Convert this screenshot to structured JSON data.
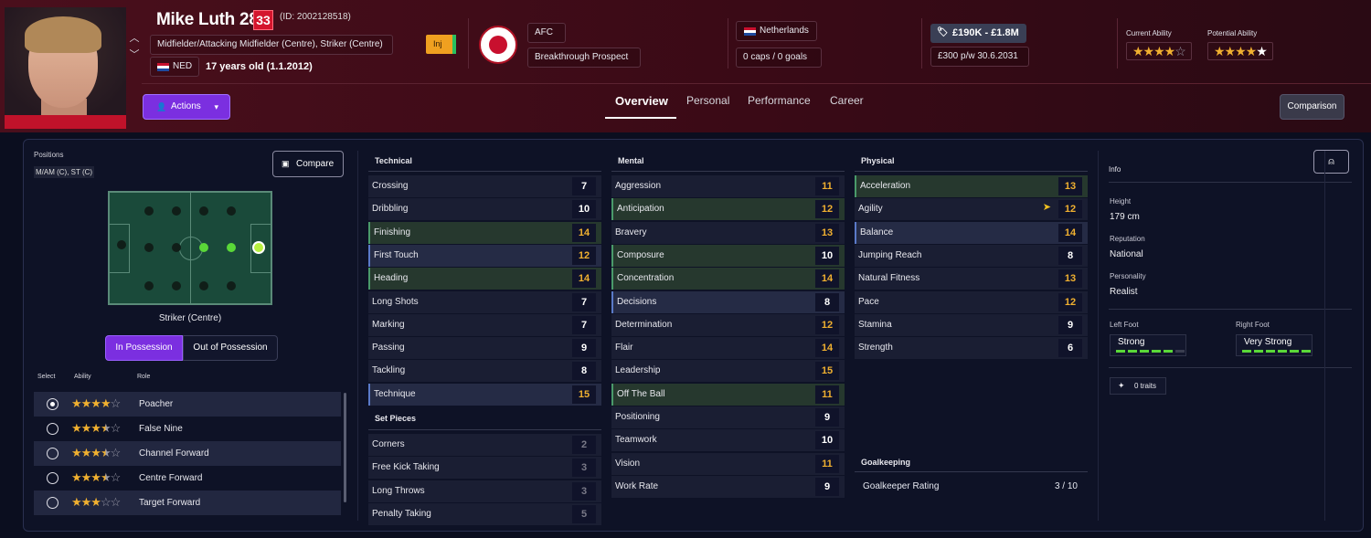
{
  "player": {
    "name": "Mike Luth 28a",
    "number": "33",
    "id": "(ID: 2002128518)",
    "positions_text": "Midfielder/Attacking Midfielder (Centre), Striker (Centre)",
    "nationality_code": "NED",
    "age_text": "17 years old (1.1.2012)",
    "status": "Inj"
  },
  "club": {
    "name": "AFC",
    "status": "Breakthrough Prospect"
  },
  "country": {
    "name": "Netherlands",
    "caps": "0 caps / 0 goals"
  },
  "contract": {
    "value": "£190K - £1.8M",
    "wage": "£300 p/w",
    "expiry": "30.6.2031"
  },
  "ability": {
    "current_label": "Current Ability",
    "current_stars": 4,
    "potential_label": "Potential Ability",
    "potential_stars": 5
  },
  "actions_label": "Actions",
  "tabs": [
    "Overview",
    "Personal",
    "Performance",
    "Career"
  ],
  "comparison_label": "Comparison",
  "left": {
    "positions_label": "Positions",
    "positions_value": "M/AM (C), ST (C)",
    "compare_label": "Compare",
    "pitch_caption": "Striker (Centre)",
    "in_possession": "In Possession",
    "out_possession": "Out of Possession",
    "col_select": "Select",
    "col_ability": "Ability",
    "col_role": "Role",
    "roles": [
      {
        "name": "Poacher",
        "stars": 4,
        "half": false,
        "selected": true
      },
      {
        "name": "False Nine",
        "stars": 3,
        "half": true,
        "selected": false
      },
      {
        "name": "Channel Forward",
        "stars": 3,
        "half": true,
        "selected": false
      },
      {
        "name": "Centre Forward",
        "stars": 3,
        "half": true,
        "selected": false
      },
      {
        "name": "Target Forward",
        "stars": 3,
        "half": false,
        "selected": false
      }
    ]
  },
  "technical": {
    "title": "Technical",
    "attrs": [
      [
        "Crossing",
        "7",
        ""
      ],
      [
        "Dribbling",
        "10",
        ""
      ],
      [
        "Finishing",
        "14",
        "hl"
      ],
      [
        "First Touch",
        "12",
        "bl"
      ],
      [
        "Heading",
        "14",
        "hl"
      ],
      [
        "Long Shots",
        "7",
        ""
      ],
      [
        "Marking",
        "7",
        ""
      ],
      [
        "Passing",
        "9",
        ""
      ],
      [
        "Tackling",
        "8",
        ""
      ],
      [
        "Technique",
        "15",
        "bl"
      ]
    ]
  },
  "setpieces": {
    "title": "Set Pieces",
    "attrs": [
      [
        "Corners",
        "2",
        ""
      ],
      [
        "Free Kick Taking",
        "3",
        ""
      ],
      [
        "Long Throws",
        "3",
        ""
      ],
      [
        "Penalty Taking",
        "5",
        ""
      ]
    ]
  },
  "mental": {
    "title": "Mental",
    "attrs": [
      [
        "Aggression",
        "11",
        ""
      ],
      [
        "Anticipation",
        "12",
        "hl"
      ],
      [
        "Bravery",
        "13",
        ""
      ],
      [
        "Composure",
        "10",
        "hl"
      ],
      [
        "Concentration",
        "14",
        "hl"
      ],
      [
        "Decisions",
        "8",
        "bl"
      ],
      [
        "Determination",
        "12",
        ""
      ],
      [
        "Flair",
        "14",
        ""
      ],
      [
        "Leadership",
        "15",
        ""
      ],
      [
        "Off The Ball",
        "11",
        "hl"
      ],
      [
        "Positioning",
        "9",
        ""
      ],
      [
        "Teamwork",
        "10",
        ""
      ],
      [
        "Vision",
        "11",
        ""
      ],
      [
        "Work Rate",
        "9",
        ""
      ]
    ]
  },
  "physical": {
    "title": "Physical",
    "attrs": [
      [
        "Acceleration",
        "13",
        "hl"
      ],
      [
        "Agility",
        "12",
        ""
      ],
      [
        "Balance",
        "14",
        "bl"
      ],
      [
        "Jumping Reach",
        "8",
        ""
      ],
      [
        "Natural Fitness",
        "13",
        ""
      ],
      [
        "Pace",
        "12",
        ""
      ],
      [
        "Stamina",
        "9",
        ""
      ],
      [
        "Strength",
        "6",
        ""
      ]
    ]
  },
  "goalkeeping": {
    "title": "Goalkeeping",
    "rating_label": "Goalkeeper Rating",
    "rating_value": "3 / 10"
  },
  "info": {
    "title": "Info",
    "height_label": "Height",
    "height": "179 cm",
    "reputation_label": "Reputation",
    "reputation": "National",
    "personality_label": "Personality",
    "personality": "Realist",
    "left_foot_label": "Left Foot",
    "left_foot": "Strong",
    "left_foot_level": 5,
    "right_foot_label": "Right Foot",
    "right_foot": "Very Strong",
    "right_foot_level": 6,
    "traits": "0 traits"
  },
  "colors": {
    "header": "#4a0f1c",
    "accent": "#7b2fe0",
    "highlight": "#f0b030",
    "green": "#5ad838"
  }
}
